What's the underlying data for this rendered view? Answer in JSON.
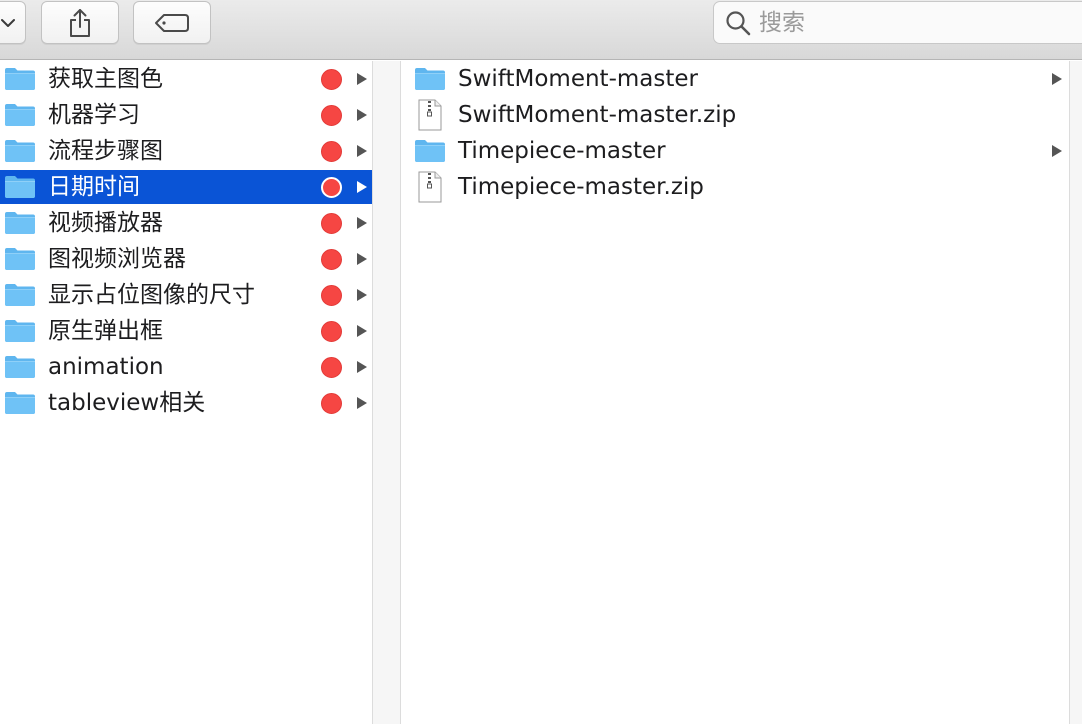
{
  "toolbar": {
    "search": {
      "placeholder": "搜索",
      "value": ""
    }
  },
  "sidebar_column": {
    "items": [
      {
        "label": "获取主图色",
        "tag_color": "#f64643",
        "selected": false,
        "has_children": true
      },
      {
        "label": "机器学习",
        "tag_color": "#f64643",
        "selected": false,
        "has_children": true
      },
      {
        "label": "流程步骤图",
        "tag_color": "#f64643",
        "selected": false,
        "has_children": true
      },
      {
        "label": "日期时间",
        "tag_color": "#f64643",
        "selected": true,
        "has_children": true
      },
      {
        "label": "视频播放器",
        "tag_color": "#f64643",
        "selected": false,
        "has_children": true
      },
      {
        "label": "图视频浏览器",
        "tag_color": "#f64643",
        "selected": false,
        "has_children": true
      },
      {
        "label": "显示占位图像的尺寸",
        "tag_color": "#f64643",
        "selected": false,
        "has_children": true
      },
      {
        "label": "原生弹出框",
        "tag_color": "#f64643",
        "selected": false,
        "has_children": true
      },
      {
        "label": "animation",
        "tag_color": "#f64643",
        "selected": false,
        "has_children": true
      },
      {
        "label": "tableview相关",
        "tag_color": "#f64643",
        "selected": false,
        "has_children": true
      }
    ]
  },
  "content_column": {
    "items": [
      {
        "label": "SwiftMoment-master",
        "kind": "folder",
        "icon": "folder-icon",
        "has_children": true
      },
      {
        "label": "SwiftMoment-master.zip",
        "kind": "zip",
        "icon": "zip-file-icon",
        "has_children": false
      },
      {
        "label": "Timepiece-master",
        "kind": "folder",
        "icon": "folder-icon",
        "has_children": true
      },
      {
        "label": "Timepiece-master.zip",
        "kind": "zip",
        "icon": "zip-file-icon",
        "has_children": false
      }
    ]
  },
  "colors": {
    "selection": "#0a54d6",
    "folder": "#5fb6ef",
    "tag_red": "#f64643"
  }
}
